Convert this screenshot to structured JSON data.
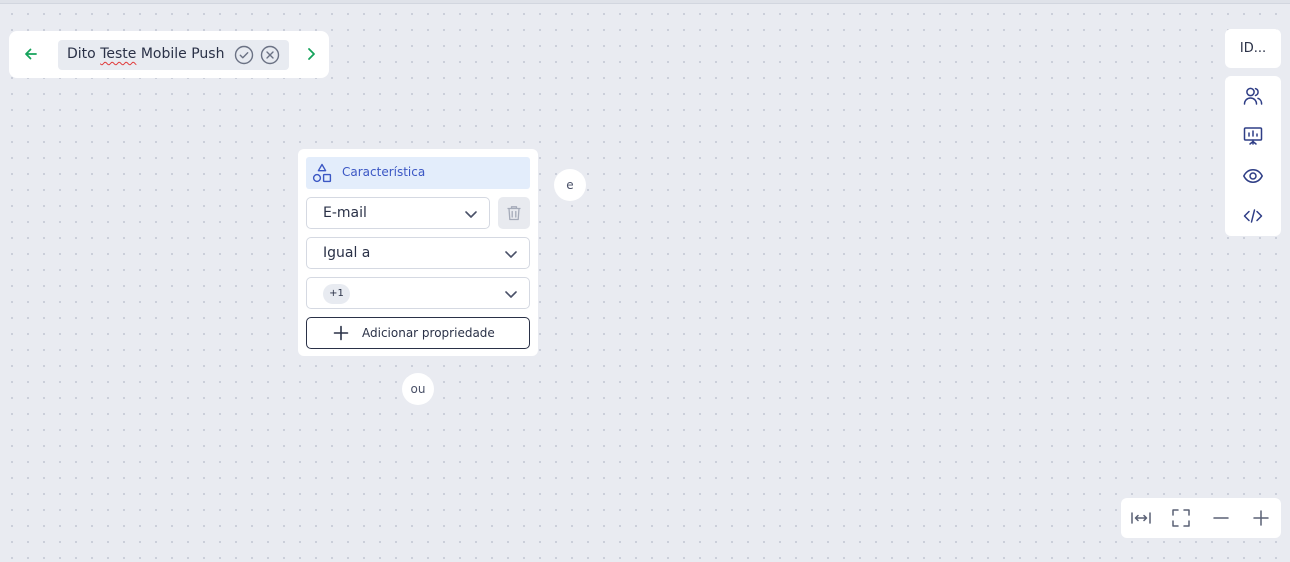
{
  "header": {
    "title_part1": "Dito",
    "title_part2": "Teste",
    "title_part3": "Mobile Push",
    "back_icon": "arrow-left-icon",
    "forward_icon": "chevron-right-icon",
    "accent_color": "#15a35b"
  },
  "right_panel": {
    "id_label": "ID...",
    "tools": [
      "users-icon",
      "presentation-icon",
      "eye-icon",
      "code-icon"
    ]
  },
  "card": {
    "header_label": "Característica",
    "field_select": "E-mail",
    "operator_select": "Igual a",
    "values_chip": "+1",
    "add_property_label": "Adicionar propriedade"
  },
  "connectors": {
    "and_label": "e",
    "or_label": "ou"
  },
  "zoom_controls": [
    "fit-width-icon",
    "fullscreen-icon",
    "zoom-out-icon",
    "zoom-in-icon"
  ]
}
